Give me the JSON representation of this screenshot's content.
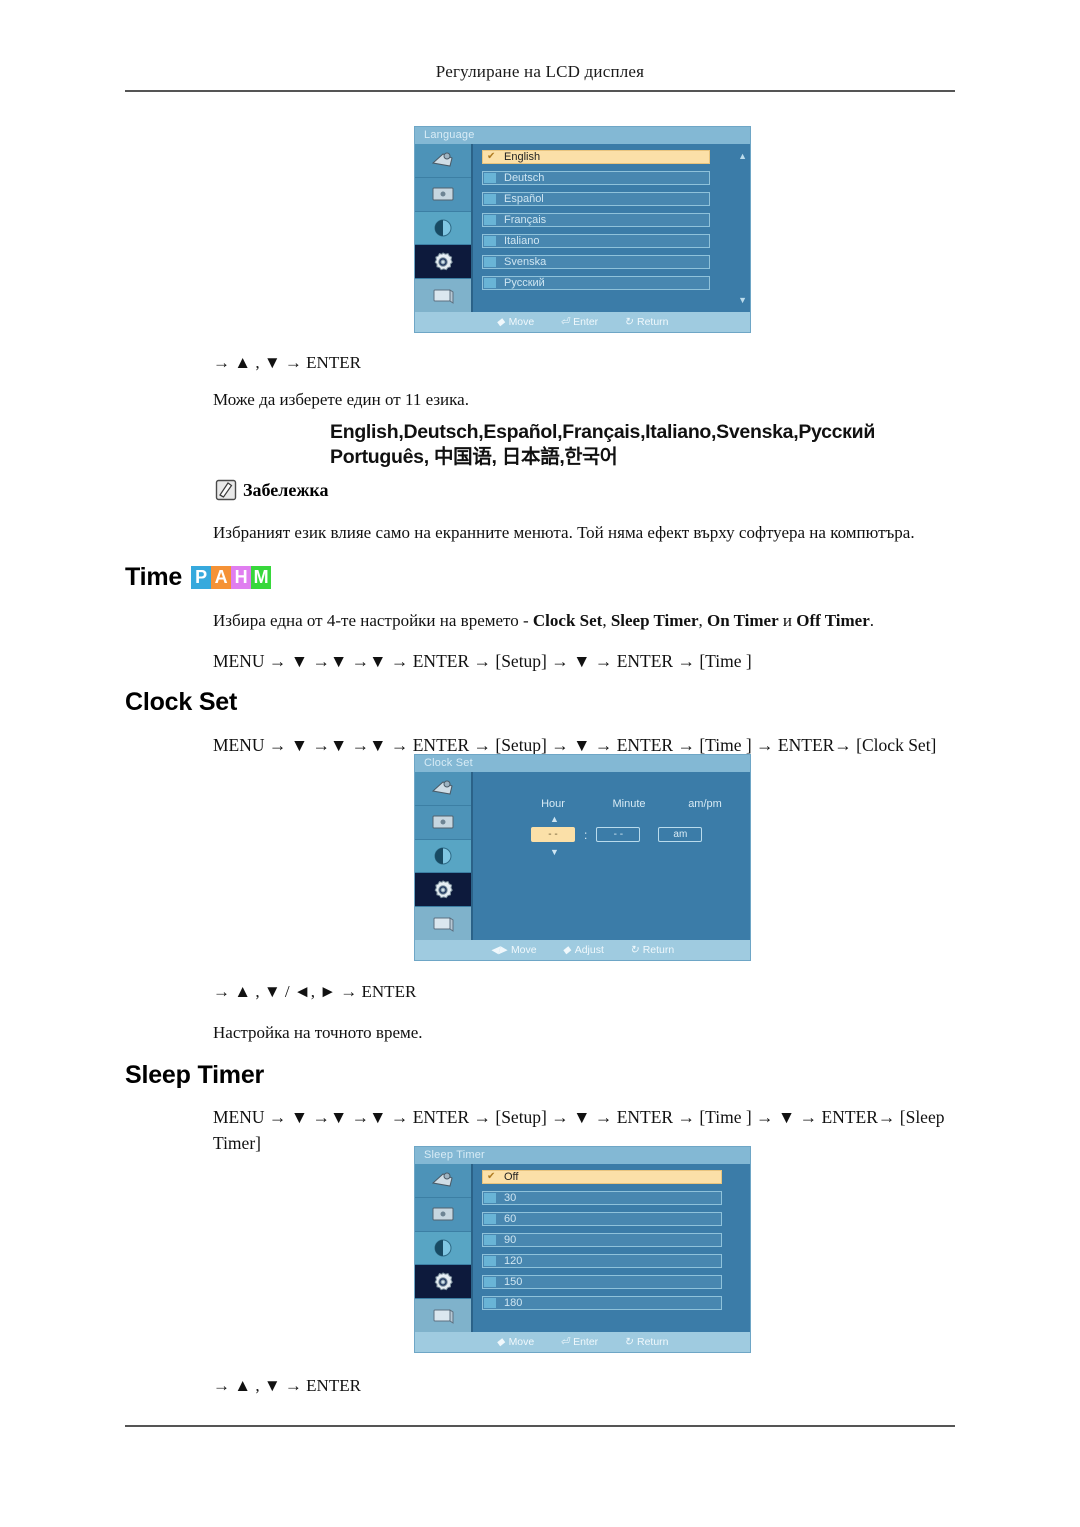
{
  "page": {
    "running_header": "Регулиране на LCD дисплея"
  },
  "language_section": {
    "osd": {
      "title": "Language",
      "items": [
        {
          "label": "English",
          "selected": true
        },
        {
          "label": "Deutsch",
          "selected": false
        },
        {
          "label": "Español",
          "selected": false
        },
        {
          "label": "Français",
          "selected": false
        },
        {
          "label": "Italiano",
          "selected": false
        },
        {
          "label": "Svenska",
          "selected": false
        },
        {
          "label": "Русский",
          "selected": false
        }
      ],
      "scroll_up": "▲",
      "scroll_down": "▼",
      "footer": [
        {
          "icon": "◆",
          "label": "Move"
        },
        {
          "icon": "⏎",
          "label": "Enter"
        },
        {
          "icon": "↻",
          "label": "Return"
        }
      ]
    },
    "keys": "→ ▲ , ▼ → ENTER",
    "description": "Може да изберете един от 11 езика.",
    "language_list_line1": "English,Deutsch,Español,Français,Italiano,Svenska,Русский",
    "language_list_line2": "Português, 中国语, 日本語,한국어",
    "note_label": "Забележка",
    "note_text": "Избраният език влияе само на екранните менюта. Той няма ефект върху софтуера на компютъра."
  },
  "time_section": {
    "heading": "Time",
    "badges": [
      {
        "letter": "P",
        "color": "#36a9dd"
      },
      {
        "letter": "A",
        "color": "#f59236"
      },
      {
        "letter": "H",
        "color": "#e07ef0"
      },
      {
        "letter": "M",
        "color": "#37d83b"
      }
    ],
    "description_prefix": "Избира една от 4-те настройки на времето - ",
    "description_items": [
      "Clock Set",
      "Sleep Timer",
      "On Timer",
      "Off Timer"
    ],
    "description_conj": " и ",
    "menu_path": "MENU → ▼ →▼ →▼ → ENTER → [Setup] → ▼ → ENTER → [Time ]"
  },
  "clock_set_section": {
    "heading": "Clock Set",
    "menu_path": "MENU → ▼ →▼ →▼ → ENTER → [Setup] → ▼ → ENTER → [Time ] → ENTER→ [Clock Set]",
    "osd": {
      "title": "Clock Set",
      "column_labels": [
        "Hour",
        "Minute",
        "am/pm"
      ],
      "hour_value": "- -",
      "minute_value": "- -",
      "ampm_value": "am",
      "separator": ":",
      "up_arrow": "▲",
      "down_arrow": "▼",
      "footer": [
        {
          "icon": "◀▶",
          "label": "Move"
        },
        {
          "icon": "◆",
          "label": "Adjust"
        },
        {
          "icon": "↻",
          "label": "Return"
        }
      ]
    },
    "keys": "→ ▲ , ▼ / ◄, ► → ENTER",
    "description": "Настройка на точното време."
  },
  "sleep_timer_section": {
    "heading": "Sleep Timer",
    "menu_path": "MENU → ▼ →▼ →▼ → ENTER → [Setup] → ▼ → ENTER → [Time ] → ▼ → ENTER→ [Sleep Timer]",
    "osd": {
      "title": "Sleep Timer",
      "items": [
        {
          "label": "Off",
          "selected": true
        },
        {
          "label": "30",
          "selected": false
        },
        {
          "label": "60",
          "selected": false
        },
        {
          "label": "90",
          "selected": false
        },
        {
          "label": "120",
          "selected": false
        },
        {
          "label": "150",
          "selected": false
        },
        {
          "label": "180",
          "selected": false
        }
      ],
      "footer": [
        {
          "icon": "◆",
          "label": "Move"
        },
        {
          "icon": "⏎",
          "label": "Enter"
        },
        {
          "icon": "↻",
          "label": "Return"
        }
      ]
    },
    "keys": "→ ▲ , ▼ → ENTER"
  }
}
